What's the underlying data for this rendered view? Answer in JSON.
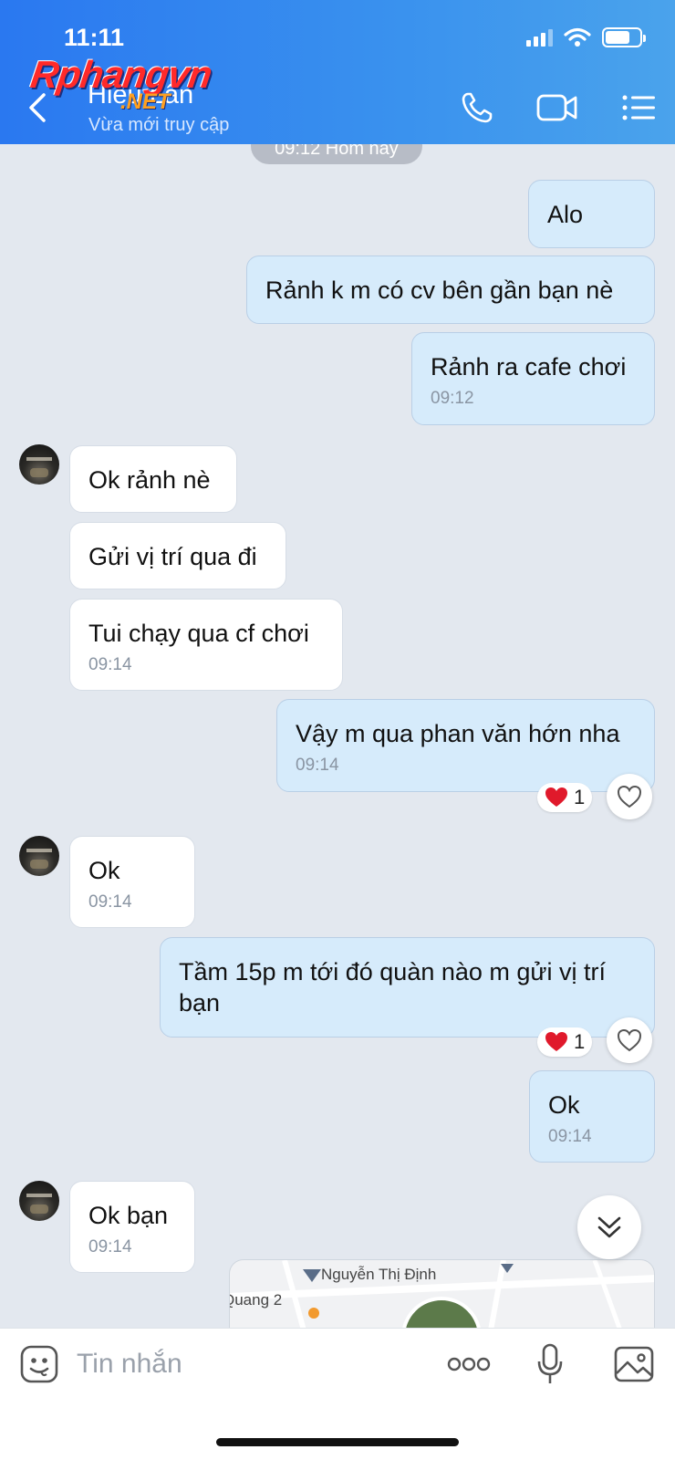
{
  "status_bar": {
    "time": "11:11"
  },
  "watermark": {
    "main": "Rphangvn",
    "sub": ".NET"
  },
  "header": {
    "contact_name": "Hiếu Lân",
    "contact_status": "Vừa mới truy cập",
    "icons": [
      "back-icon",
      "phone-icon",
      "video-icon",
      "menu-icon"
    ]
  },
  "chat": {
    "date_separator": "09:12 Hôm nay",
    "messages": [
      {
        "dir": "out",
        "text": "Alo",
        "time": ""
      },
      {
        "dir": "out",
        "text": "Rảnh k m có cv bên gần bạn nè",
        "time": ""
      },
      {
        "dir": "out",
        "text": "Rảnh ra cafe chơi",
        "time": "09:12"
      },
      {
        "dir": "in",
        "text": "Ok rảnh nè",
        "time": ""
      },
      {
        "dir": "in",
        "text": "Gửi vị trí qua đi",
        "time": ""
      },
      {
        "dir": "in",
        "text": "Tui chạy qua cf chơi",
        "time": "09:14"
      },
      {
        "dir": "out",
        "text": "Vậy m qua phan văn hớn nha",
        "time": "09:14",
        "reaction": {
          "emoji": "heart",
          "count": "1"
        }
      },
      {
        "dir": "in",
        "text": "Ok",
        "time": "09:14"
      },
      {
        "dir": "out",
        "text": "Tầm 15p m tới đó quàn nào m gửi vị trí bạn",
        "time": "",
        "reaction": {
          "emoji": "heart",
          "count": "1"
        }
      },
      {
        "dir": "out",
        "text": "Ok",
        "time": "09:14"
      },
      {
        "dir": "in",
        "text": "Ok bạn",
        "time": "09:14"
      }
    ],
    "map_card": {
      "street_1": "Nguyễn Thị Định",
      "street_2": "Quang 2"
    }
  },
  "composer": {
    "placeholder": "Tin nhắn"
  },
  "colors": {
    "header_start": "#2a78f0",
    "header_end": "#4aa3ec",
    "outgoing_bubble": "#d6ebfb",
    "incoming_bubble": "#ffffff",
    "chat_bg": "#e3e8ef"
  }
}
